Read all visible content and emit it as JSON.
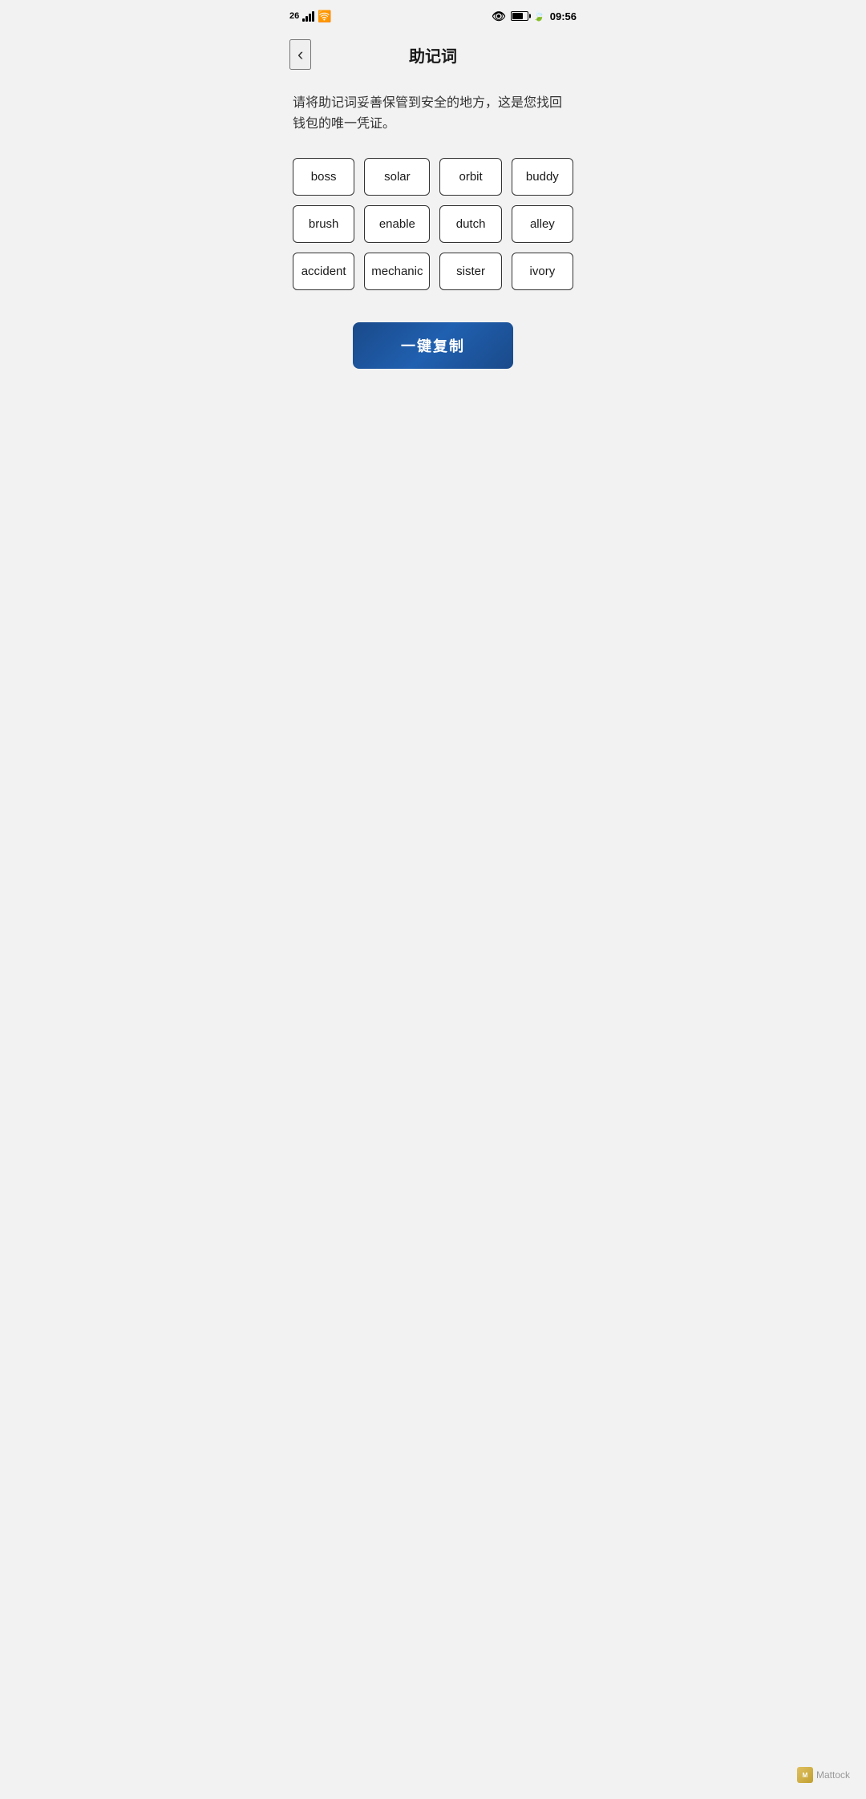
{
  "statusBar": {
    "network": "26",
    "time": "09:56",
    "batteryLevel": 76
  },
  "navBar": {
    "backLabel": "‹",
    "title": "助记词"
  },
  "description": "请将助记词妥善保管到安全的地方，这是您找回钱包的唯一凭证。",
  "mnemonicWords": [
    "boss",
    "solar",
    "orbit",
    "buddy",
    "brush",
    "enable",
    "dutch",
    "alley",
    "accident",
    "mechanic",
    "sister",
    "ivory"
  ],
  "copyButton": {
    "label": "一键复制"
  },
  "footer": {
    "watermark": "Mattock"
  }
}
